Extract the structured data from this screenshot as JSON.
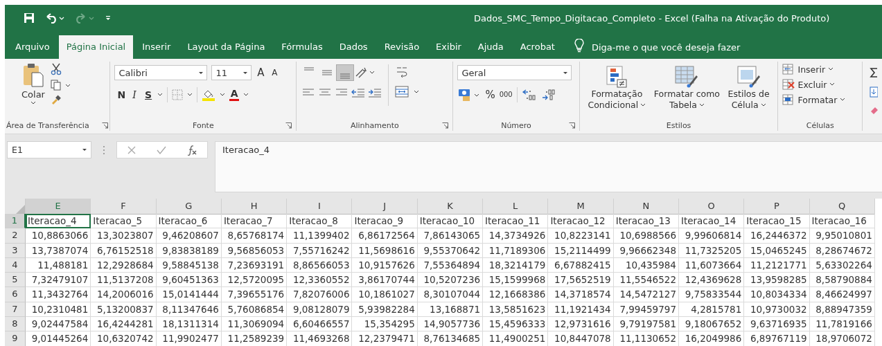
{
  "window": {
    "title": "Dados_SMC_Tempo_Digitacao_Completo  -  Excel (Falha na Ativação do Produto)"
  },
  "tabs": [
    {
      "label": "Arquivo",
      "selected": false
    },
    {
      "label": "Página Inicial",
      "selected": true
    },
    {
      "label": "Inserir",
      "selected": false
    },
    {
      "label": "Layout da Página",
      "selected": false
    },
    {
      "label": "Fórmulas",
      "selected": false
    },
    {
      "label": "Dados",
      "selected": false
    },
    {
      "label": "Revisão",
      "selected": false
    },
    {
      "label": "Exibir",
      "selected": false
    },
    {
      "label": "Ajuda",
      "selected": false
    },
    {
      "label": "Acrobat",
      "selected": false
    }
  ],
  "tell_me": {
    "placeholder": "Diga-me o que você deseja fazer"
  },
  "ribbon": {
    "clipboard": {
      "label": "Área de Transferência",
      "paste": "Colar"
    },
    "font": {
      "label": "Fonte",
      "font_name": "Calibri",
      "font_size": "11",
      "grow": "A",
      "shrink": "A",
      "bold": "N",
      "italic": "I",
      "underline": "S",
      "font_color": "A"
    },
    "alignment": {
      "label": "Alinhamento"
    },
    "number": {
      "label": "Número",
      "format": "Geral",
      "percent": "%",
      "thousands": "000"
    },
    "styles": {
      "label": "Estilos",
      "buttons": [
        {
          "lines": [
            "Formatação",
            "Condicional"
          ]
        },
        {
          "lines": [
            "Formatar como",
            "Tabela"
          ]
        },
        {
          "lines": [
            "Estilos de",
            "Célula"
          ]
        }
      ]
    },
    "cells": {
      "label": "Células",
      "items": [
        "Inserir",
        "Excluir",
        "Formatar"
      ]
    }
  },
  "formula_bar": {
    "name_box": "E1",
    "value": "Iteracao_4"
  },
  "table": {
    "columns": [
      {
        "letter": "E",
        "selected": true
      },
      {
        "letter": "F",
        "selected": false
      },
      {
        "letter": "G",
        "selected": false
      },
      {
        "letter": "H",
        "selected": false
      },
      {
        "letter": "I",
        "selected": false
      },
      {
        "letter": "J",
        "selected": false
      },
      {
        "letter": "K",
        "selected": false
      },
      {
        "letter": "L",
        "selected": false
      },
      {
        "letter": "M",
        "selected": false
      },
      {
        "letter": "N",
        "selected": false
      },
      {
        "letter": "O",
        "selected": false
      },
      {
        "letter": "P",
        "selected": false
      },
      {
        "letter": "Q",
        "selected": false
      }
    ],
    "rows": [
      {
        "number": "1",
        "selected": true,
        "kind": "text",
        "cells": [
          "Iteracao_4",
          "Iteracao_5",
          "Iteracao_6",
          "Iteracao_7",
          "Iteracao_8",
          "Iteracao_9",
          "Iteracao_10",
          "Iteracao_11",
          "Iteracao_12",
          "Iteracao_13",
          "Iteracao_14",
          "Iteracao_15",
          "Iteracao_16"
        ]
      },
      {
        "number": "2",
        "selected": false,
        "kind": "number",
        "cells": [
          "10,8863066",
          "13,3023807",
          "9,46208607",
          "8,65768174",
          "11,1399402",
          "6,86172564",
          "7,86143065",
          "14,3734926",
          "10,8223141",
          "10,6988566",
          "9,99606814",
          "16,2446372",
          "9,95010801"
        ]
      },
      {
        "number": "3",
        "selected": false,
        "kind": "number",
        "cells": [
          "13,7387074",
          "6,76152518",
          "9,83838189",
          "9,56856053",
          "7,55716242",
          "11,5698616",
          "9,55370642",
          "11,7189306",
          "15,2114499",
          "9,96662348",
          "11,7325205",
          "15,0465245",
          "8,28674672"
        ]
      },
      {
        "number": "4",
        "selected": false,
        "kind": "number",
        "cells": [
          "11,488181",
          "12,2928684",
          "9,58845138",
          "7,23693191",
          "8,86566053",
          "10,9157626",
          "7,55364894",
          "18,3214179",
          "6,67882415",
          "10,435984",
          "11,6073664",
          "11,2121771",
          "5,63302264"
        ]
      },
      {
        "number": "5",
        "selected": false,
        "kind": "number",
        "cells": [
          "7,32479107",
          "11,5137208",
          "9,60451363",
          "12,5720095",
          "12,3360552",
          "3,86170744",
          "10,5207236",
          "15,1599968",
          "17,5652519",
          "11,5546522",
          "12,4369628",
          "13,9598285",
          "8,58790884"
        ]
      },
      {
        "number": "6",
        "selected": false,
        "kind": "number",
        "cells": [
          "11,3432764",
          "14,2006016",
          "15,0141444",
          "7,39655176",
          "7,82076006",
          "10,1861027",
          "8,30107044",
          "12,1668386",
          "14,3718574",
          "14,5472127",
          "9,75833544",
          "10,8034334",
          "8,46624997"
        ]
      },
      {
        "number": "7",
        "selected": false,
        "kind": "number",
        "cells": [
          "10,2310481",
          "5,13200837",
          "8,11347646",
          "5,76086854",
          "9,08128079",
          "5,93982284",
          "13,168871",
          "13,5851623",
          "11,1921434",
          "7,99459797",
          "4,2815781",
          "10,9730032",
          "8,88947359"
        ]
      },
      {
        "number": "8",
        "selected": false,
        "kind": "number",
        "cells": [
          "9,02447584",
          "16,4244281",
          "18,1311314",
          "11,3069094",
          "6,60466557",
          "15,354295",
          "14,9057736",
          "15,4596333",
          "12,9731616",
          "9,79197581",
          "9,18067652",
          "9,63716935",
          "11,7819166"
        ]
      },
      {
        "number": "9",
        "selected": false,
        "kind": "number",
        "cells": [
          "9,01445264",
          "10,6320742",
          "11,9902477",
          "11,2589239",
          "11,4693268",
          "12,2379471",
          "8,76134685",
          "11,4900251",
          "10,8447078",
          "11,1130652",
          "16,2049986",
          "6,89767119",
          "18,9706072"
        ]
      }
    ]
  }
}
